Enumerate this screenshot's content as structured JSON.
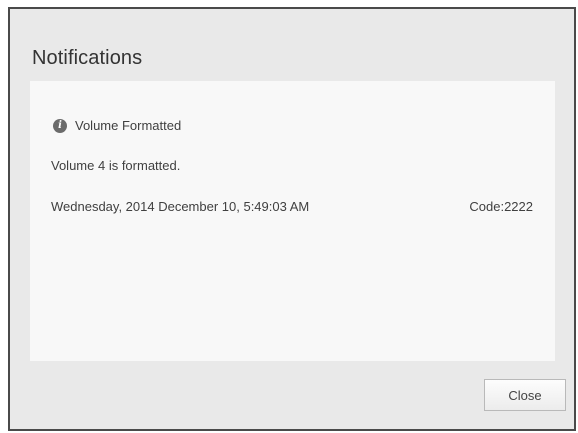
{
  "dialog": {
    "title": "Notifications",
    "close_label": "Close"
  },
  "notification": {
    "icon": "info-icon",
    "title": "Volume Formatted",
    "message": "Volume 4 is formatted.",
    "timestamp": "Wednesday, 2014 December 10, 5:49:03 AM",
    "code": "Code:2222"
  }
}
